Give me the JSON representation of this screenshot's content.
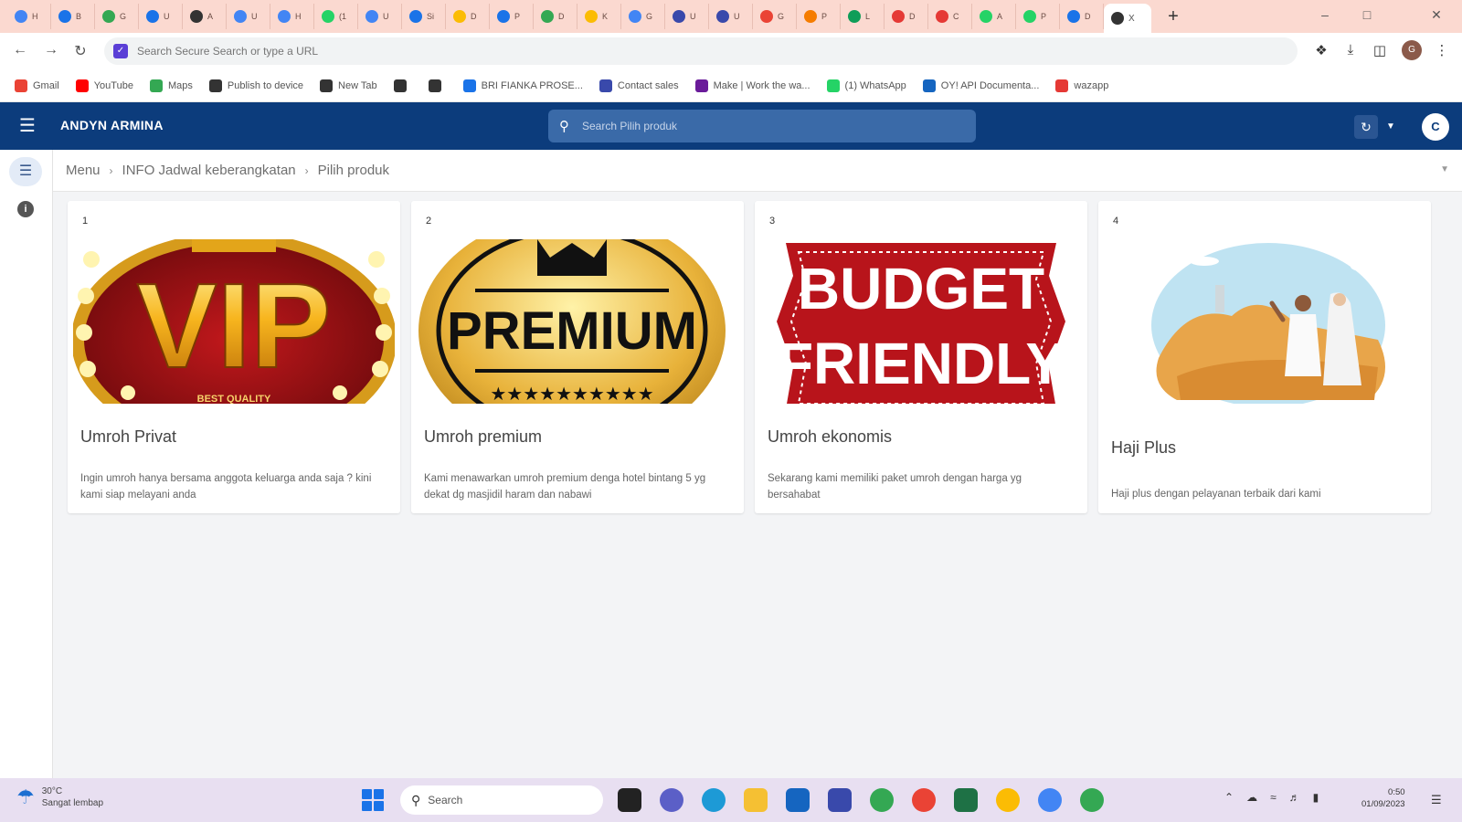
{
  "browser": {
    "tabs": [
      {
        "label": "H",
        "color": "#4285f4"
      },
      {
        "label": "B",
        "color": "#1a73e8"
      },
      {
        "label": "G",
        "color": "#34a853"
      },
      {
        "label": "U",
        "color": "#1a73e8"
      },
      {
        "label": "A",
        "color": "#333333"
      },
      {
        "label": "U",
        "color": "#4285f4"
      },
      {
        "label": "H",
        "color": "#4285f4"
      },
      {
        "label": "(1",
        "color": "#25d366"
      },
      {
        "label": "U",
        "color": "#4285f4"
      },
      {
        "label": "Si",
        "color": "#1a73e8"
      },
      {
        "label": "D",
        "color": "#fbbc04"
      },
      {
        "label": "P",
        "color": "#1a73e8"
      },
      {
        "label": "D",
        "color": "#34a853"
      },
      {
        "label": "K",
        "color": "#fbbc04"
      },
      {
        "label": "G",
        "color": "#4285f4"
      },
      {
        "label": "U",
        "color": "#3949ab"
      },
      {
        "label": "U",
        "color": "#3949ab"
      },
      {
        "label": "G",
        "color": "#ea4335"
      },
      {
        "label": "P",
        "color": "#f57c00"
      },
      {
        "label": "L",
        "color": "#0f9d58"
      },
      {
        "label": "D",
        "color": "#e53935"
      },
      {
        "label": "C",
        "color": "#e53935"
      },
      {
        "label": "A",
        "color": "#25d366"
      },
      {
        "label": "P",
        "color": "#25d366"
      },
      {
        "label": "D",
        "color": "#1a73e8"
      }
    ],
    "active_tab_label": "X",
    "omnibox_placeholder": "Search Secure Search or type a URL",
    "bookmarks": [
      {
        "label": "Gmail",
        "color": "#ea4335"
      },
      {
        "label": "YouTube",
        "color": "#ff0000"
      },
      {
        "label": "Maps",
        "color": "#34a853"
      },
      {
        "label": "Publish to device",
        "color": "#333333"
      },
      {
        "label": "New Tab",
        "color": "#333333"
      },
      {
        "label": "",
        "color": "#333333"
      },
      {
        "label": "",
        "color": "#333333"
      },
      {
        "label": "BRI FIANKA PROSE...",
        "color": "#1a73e8"
      },
      {
        "label": "Contact sales",
        "color": "#3949ab"
      },
      {
        "label": "Make | Work the wa...",
        "color": "#6a1b9a"
      },
      {
        "label": "(1) WhatsApp",
        "color": "#25d366"
      },
      {
        "label": "OY! API Documenta...",
        "color": "#1565c0"
      },
      {
        "label": "wazapp",
        "color": "#e53935"
      }
    ]
  },
  "app": {
    "name": "ANDYN ARMINA",
    "search_placeholder": "Search Pilih produk",
    "avatar_initial": "C",
    "accent": "#0c3c7c"
  },
  "breadcrumb": [
    "Menu",
    "INFO Jadwal keberangkatan",
    "Pilih produk"
  ],
  "products": [
    {
      "number": "1",
      "title": "Umroh Privat",
      "description": "Ingin umroh hanya bersama anggota keluarga anda saja ? kini kami siap melayani anda",
      "badge": "vip"
    },
    {
      "number": "2",
      "title": "Umroh premium",
      "description": "Kami menawarkan umroh premium denga hotel bintang 5 yg dekat dg masjidil haram dan nabawi",
      "badge": "premium"
    },
    {
      "number": "3",
      "title": "Umroh ekonomis",
      "description": "Sekarang kami memiliki paket umroh dengan harga yg bersahabat",
      "badge": "budget"
    },
    {
      "number": "4",
      "title": "Haji Plus",
      "description": "Haji plus dengan pelayanan terbaik dari kami",
      "badge": "hajj"
    }
  ],
  "badge_text": {
    "vip": "VIP",
    "vip_sub": "BEST QUALITY",
    "premium": "PREMIUM",
    "budget_1": "BUDGET",
    "budget_2": "FRIENDLY"
  },
  "taskbar": {
    "temperature": "30°C",
    "weather_desc": "Sangat lembap",
    "search_label": "Search",
    "time": "0:50",
    "date": "01/09/2023"
  }
}
